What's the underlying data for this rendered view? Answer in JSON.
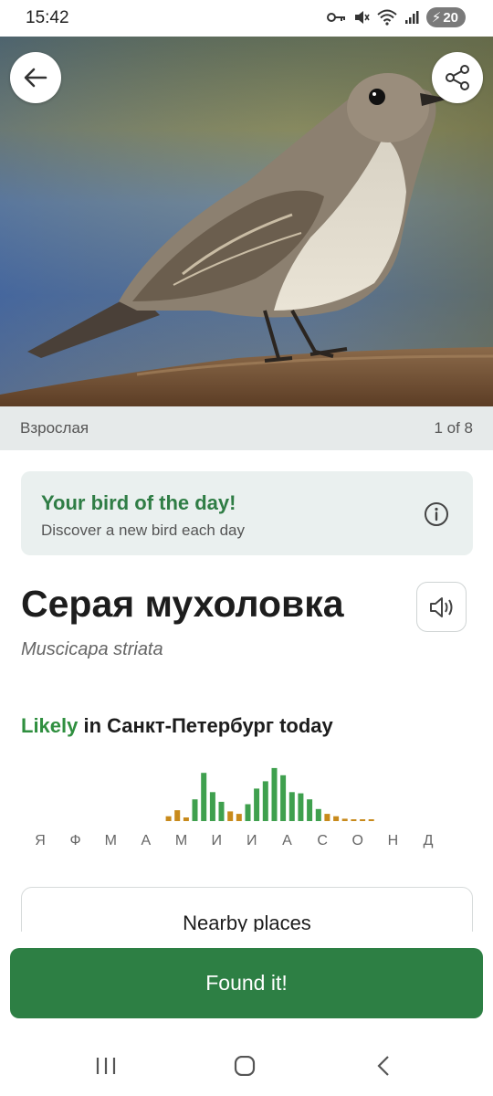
{
  "status_bar": {
    "time": "15:42",
    "battery": "20",
    "icons": [
      "key-icon",
      "mute-icon",
      "wifi-icon",
      "signal-icon",
      "battery-icon"
    ]
  },
  "hero": {
    "image": "photo of a grey flycatcher perched on a log",
    "back_icon": "arrow-left-icon",
    "share_icon": "share-icon"
  },
  "caption": {
    "label": "Взрослая",
    "counter": "1 of 8"
  },
  "bird_of_day": {
    "title": "Your bird of the day!",
    "subtitle": "Discover a new bird each day",
    "info_icon": "info-icon"
  },
  "bird": {
    "common_name": "Серая мухоловка",
    "scientific_name": "Muscicapa striata",
    "sound_icon": "speaker-icon"
  },
  "likelihood": {
    "word": "Likely",
    "rest": " in Санкт-Петербург today"
  },
  "chart_data": {
    "type": "bar",
    "categories": [
      "Я",
      "Ф",
      "М",
      "А",
      "М",
      "И",
      "И",
      "А",
      "С",
      "О",
      "Н",
      "Д"
    ],
    "bins_per_month": 4,
    "values": [
      0,
      0,
      0,
      0,
      0,
      0,
      0,
      0,
      0,
      0,
      0,
      0,
      0,
      0,
      0,
      0,
      0.08,
      0.18,
      0.06,
      0.36,
      0.8,
      0.48,
      0.32,
      0.16,
      0.12,
      0.28,
      0.54,
      0.66,
      0.88,
      0.76,
      0.48,
      0.46,
      0.36,
      0.2,
      0.12,
      0.08,
      0.04,
      0.03,
      0.03,
      0.03,
      0,
      0,
      0,
      0,
      0,
      0,
      0,
      0
    ],
    "colors": {
      "high": "#3fa04e",
      "low": "#c88a1c"
    },
    "low_threshold": 0.2
  },
  "nearby": {
    "title": "Nearby places"
  },
  "found_button": "Found it!",
  "nav": {
    "recents_icon": "recents-icon",
    "home_icon": "home-icon",
    "back_icon": "back-icon"
  }
}
